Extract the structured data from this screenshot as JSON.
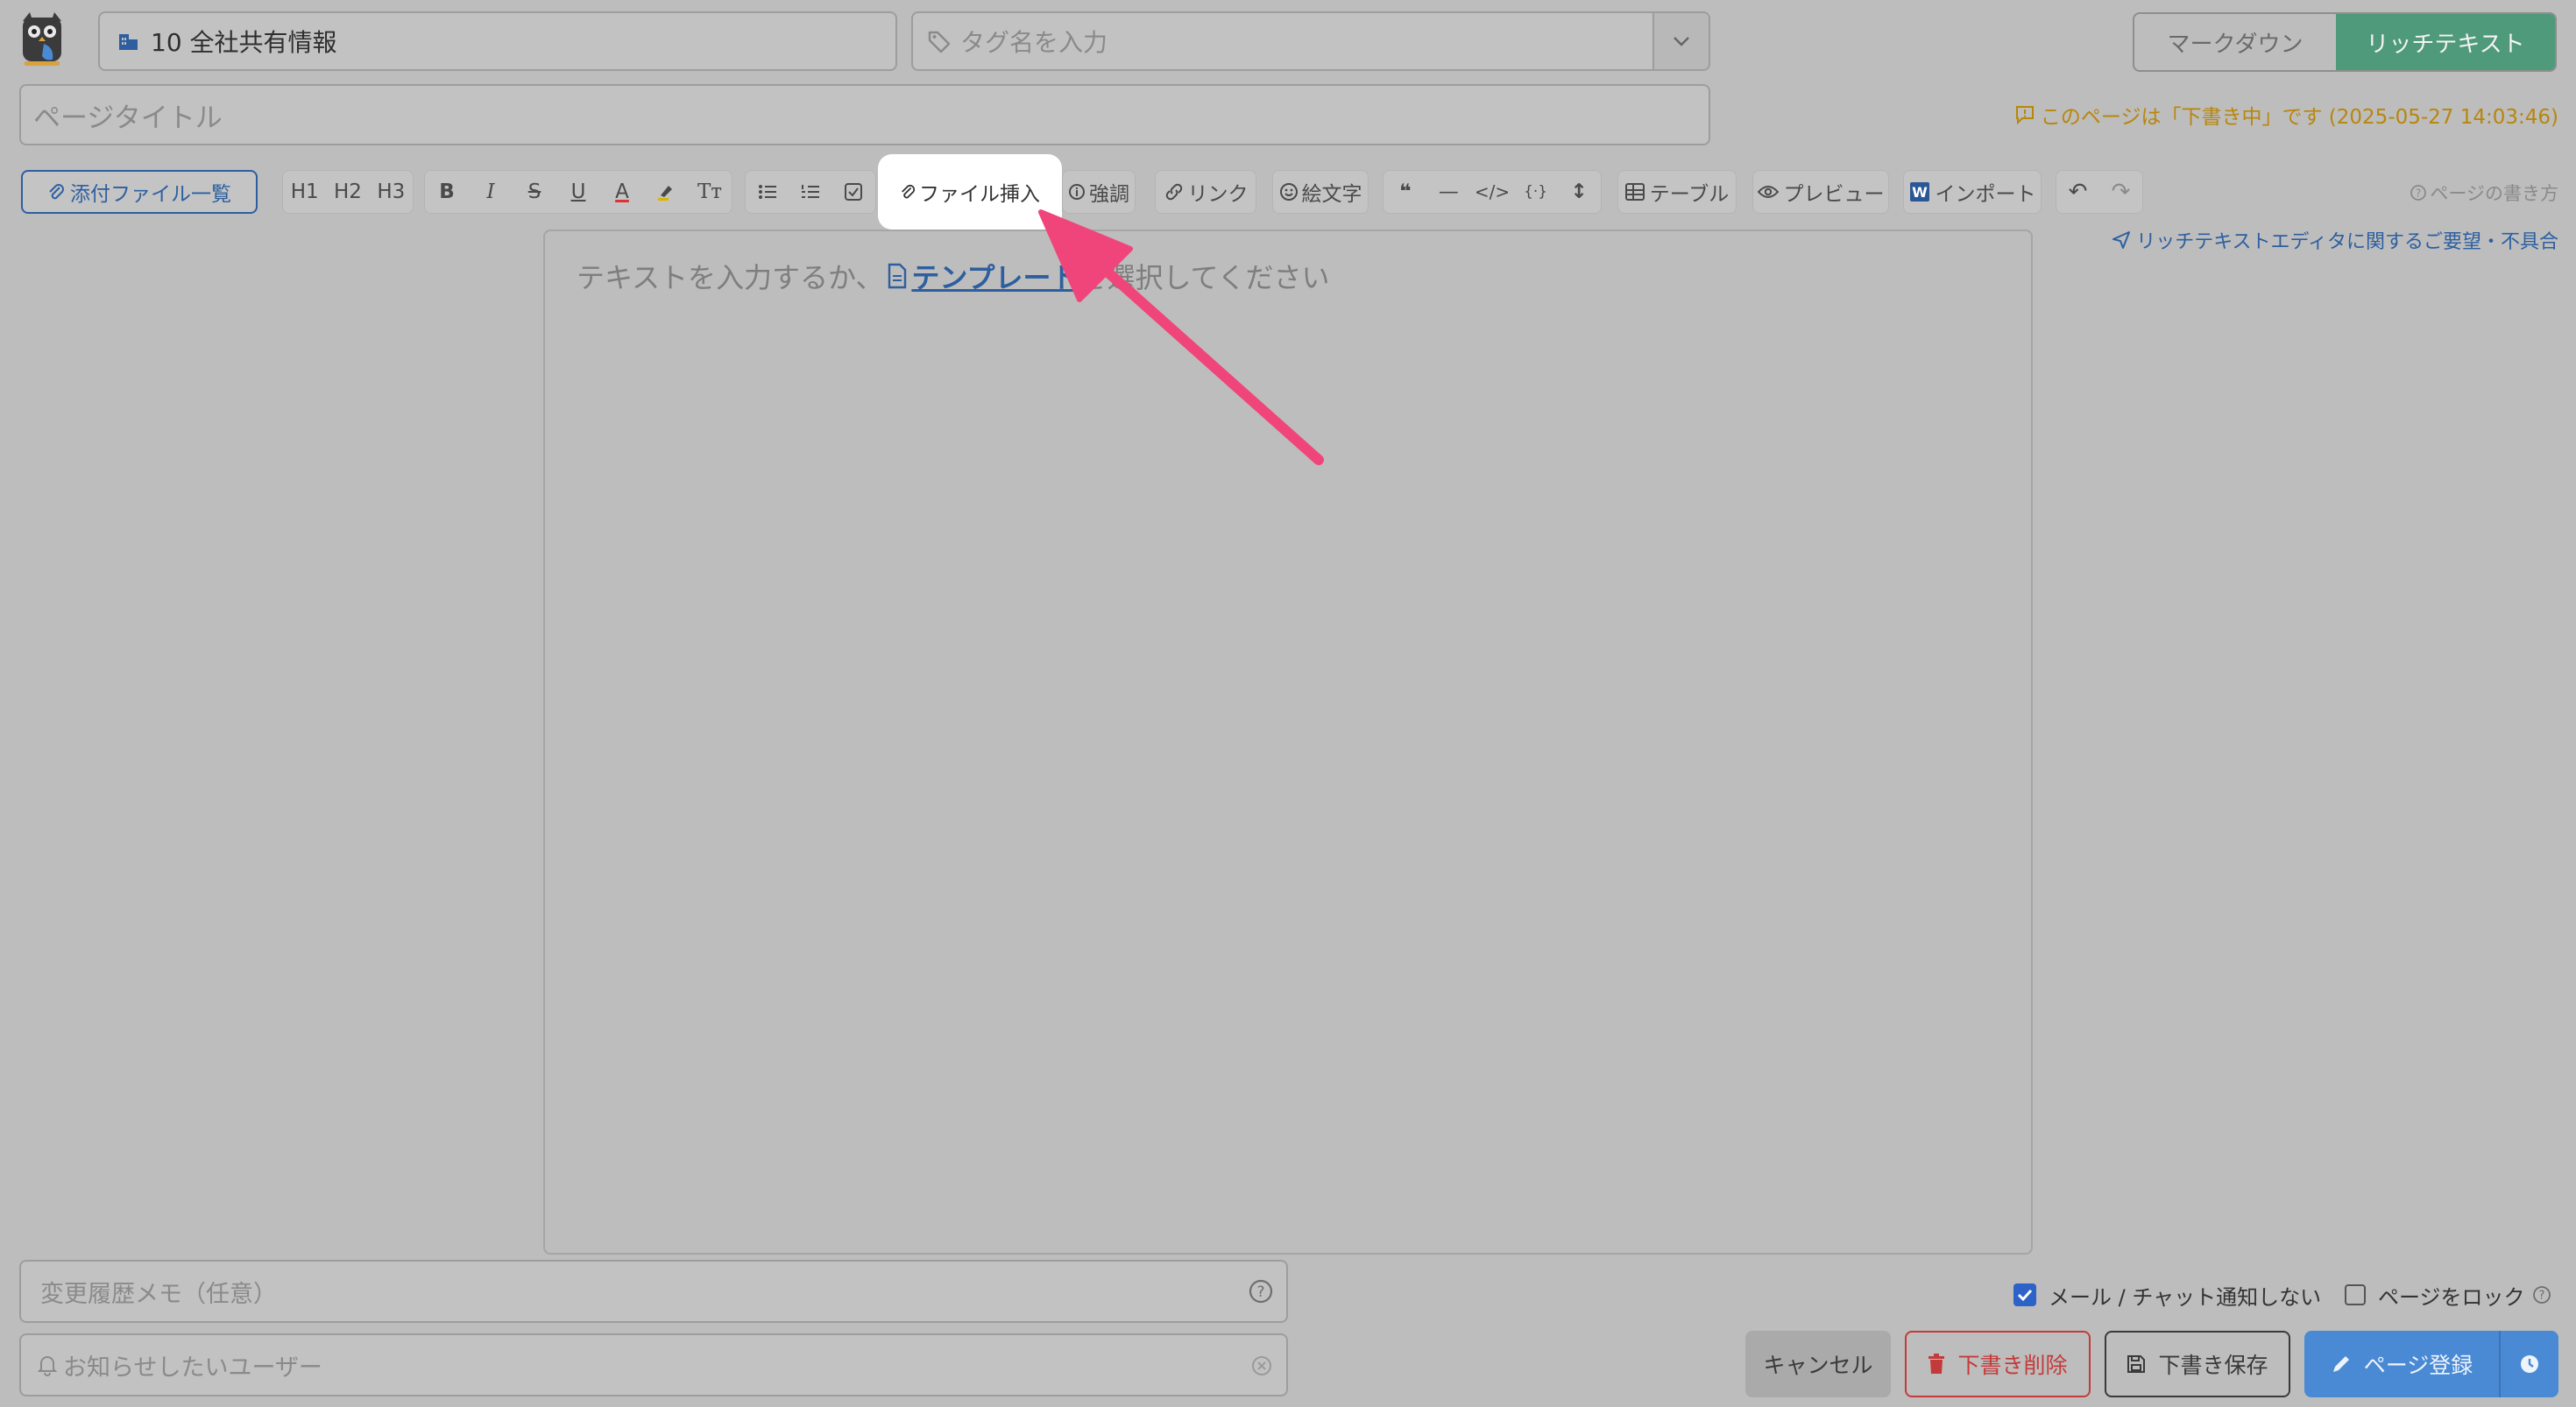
{
  "header": {
    "logo": "owl-logo",
    "group_value": "10 全社共有情報",
    "tag_placeholder": "タグ名を入力",
    "mode_tabs": [
      "マークダウン",
      "リッチテキスト"
    ],
    "active_mode": "リッチテキスト"
  },
  "title_placeholder": "ページタイトル",
  "draft_notice": "このページは「下書き中」です (2025-05-27 14:03:46)",
  "toolbar": {
    "attachments_label": "添付ファイル一覧",
    "h1": "H1",
    "h2": "H2",
    "h3": "H3",
    "bold": "B",
    "italic": "I",
    "strike": "S",
    "underline": "U",
    "color": "A",
    "clear_format": "Tт",
    "file_insert": "ファイル挿入",
    "emphasis": "強調",
    "link": "リンク",
    "emoji": "絵文字",
    "quote": "❝",
    "hr": "—",
    "code": "</>",
    "embed": "{·}",
    "spacing": "↕",
    "table": "テーブル",
    "preview": "プレビュー",
    "import": "インポート",
    "undo": "↶",
    "redo": "↷",
    "help": "ページの書き方"
  },
  "feedback_link": "リッチテキストエディタに関するご要望・不具合",
  "editor": {
    "prompt_before": "テキストを入力するか、",
    "template_link": "テンプレート",
    "prompt_after": "を選択してください"
  },
  "footer": {
    "memo_placeholder": "変更履歴メモ（任意）",
    "notify_placeholder": "お知らせしたいユーザー",
    "no_notify_label": "メール / チャット通知しない",
    "no_notify_checked": true,
    "lock_label": "ページをロック",
    "lock_checked": false,
    "cancel": "キャンセル",
    "delete_draft": "下書き削除",
    "save_draft": "下書き保存",
    "register": "ページ登録"
  },
  "colors": {
    "accent_green": "#4f9a7a",
    "link_blue": "#2d5fa0",
    "draft_orange": "#b8860b",
    "danger_red": "#c43a3a",
    "primary_blue": "#4a8ad4",
    "arrow_pink": "#f0457a"
  }
}
